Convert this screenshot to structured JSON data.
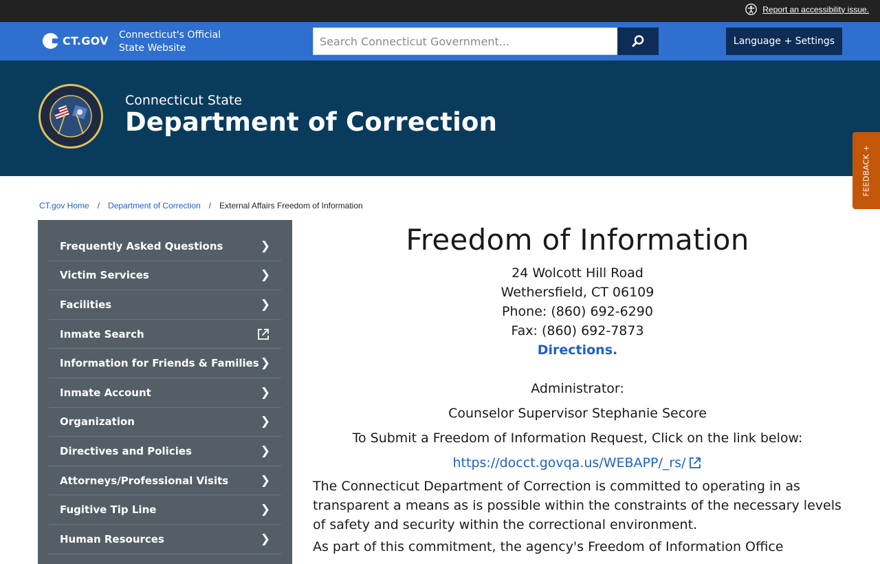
{
  "utility": {
    "accessibility_link": "Report an accessibility issue."
  },
  "ctgov": {
    "logo_text": "CT.GOV",
    "tagline_line1": "Connecticut's Official",
    "tagline_line2": "State Website",
    "search_placeholder": "Search Connecticut Government...",
    "language_button": "Language + Settings"
  },
  "agency": {
    "kicker": "Connecticut State",
    "name": "Department of Correction"
  },
  "feedback_label": "FEEDBACK +",
  "breadcrumb": {
    "home": "CT.gov Home",
    "agency": "Department of Correction",
    "current": "External Affairs Freedom of Information",
    "separator": "/"
  },
  "sidebar": {
    "items": [
      {
        "label": "Frequently Asked Questions",
        "icon": "chevron-right"
      },
      {
        "label": "Victim Services",
        "icon": "chevron-right"
      },
      {
        "label": "Facilities",
        "icon": "chevron-right"
      },
      {
        "label": "Inmate Search",
        "icon": "external-link"
      },
      {
        "label": "Information for Friends & Families",
        "icon": "chevron-right"
      },
      {
        "label": "Inmate Account",
        "icon": "chevron-right"
      },
      {
        "label": "Organization",
        "icon": "chevron-right"
      },
      {
        "label": "Directives and Policies",
        "icon": "chevron-right"
      },
      {
        "label": "Attorneys/Professional Visits",
        "icon": "chevron-right"
      },
      {
        "label": "Fugitive Tip Line",
        "icon": "chevron-right"
      },
      {
        "label": "Human Resources",
        "icon": "chevron-right"
      }
    ]
  },
  "main": {
    "title": "Freedom of Information",
    "address_line1": "24 Wolcott Hill Road",
    "address_line2": "Wethersfield, CT 06109",
    "phone": "Phone: (860) 692-6290",
    "fax": "Fax: (860) 692-7873",
    "directions": "Directions.",
    "admin_label": "Administrator:",
    "admin_name": "Counselor Supervisor Stephanie Secore",
    "submit_text": "To Submit a Freedom of Information Request, Click on the link below:",
    "request_url": "https://docct.govqa.us/WEBAPP/_rs/",
    "paragraph1": "The Connecticut Department of Correction is committed to operating in as transparent a means as is possible within the constraints of the necessary levels of safety and security within the correctional environment.",
    "paragraph2": "As part of this commitment, the agency's Freedom of Information Office"
  },
  "colors": {
    "utility_bar": "#222222",
    "ctgov_blue": "#2e6fcf",
    "navy": "#0d2d57",
    "banner": "#093b5c",
    "sidebar": "#535e66",
    "feedback": "#c4560a",
    "link": "#2060c8"
  }
}
